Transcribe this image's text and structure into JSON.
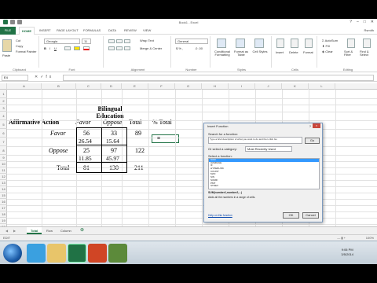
{
  "window": {
    "title": "Book1 - Excel",
    "user": "Rsmith"
  },
  "ribbon_tabs": [
    "FILE",
    "HOME",
    "INSERT",
    "PAGE LAYOUT",
    "FORMULAS",
    "DATA",
    "REVIEW",
    "VIEW"
  ],
  "ribbon": {
    "clipboard": {
      "cut": "Cut",
      "copy": "Copy",
      "format_painter": "Format Painter",
      "paste": "Paste",
      "group": "Clipboard"
    },
    "font": {
      "name": "Georgia",
      "size": "11",
      "group": "Font"
    },
    "alignment": {
      "wrap": "Wrap Text",
      "merge": "Merge & Center",
      "group": "Alignment"
    },
    "number": {
      "format": "General",
      "group": "Number"
    },
    "styles": {
      "conditional": "Conditional Formatting",
      "format_table": "Format as Table",
      "cell_styles": "Cell Styles",
      "group": "Styles"
    },
    "cells": {
      "insert": "Insert",
      "delete": "Delete",
      "format": "Format",
      "group": "Cells"
    },
    "editing": {
      "autosum": "AutoSum",
      "fill": "Fill",
      "clear": "Clear",
      "sort": "Sort & Filter",
      "find": "Find & Select",
      "group": "Editing"
    }
  },
  "formula_bar": {
    "name_box": "E4",
    "fx": "fx"
  },
  "columns": [
    "A",
    "B",
    "C",
    "D",
    "E",
    "F",
    "G",
    "H",
    "I",
    "J",
    "K",
    "L"
  ],
  "rows": [
    "1",
    "2",
    "3",
    "4",
    "5",
    "6",
    "7",
    "8",
    "9",
    "10",
    "11",
    "12",
    "13",
    "14",
    "15",
    "16",
    "17",
    "18",
    "19",
    "20",
    "21"
  ],
  "sheet": {
    "header_top": "Bilingual",
    "header_bottom": "Education",
    "affirmative": "Affirmative Action",
    "favor_col": "Favor",
    "oppose_col": "Oppose",
    "total_col": "Total",
    "pct_total": "% Total",
    "favor_row": "Favor",
    "oppose_row": "Oppose",
    "total_row": "Total",
    "r_favor_favor": "56",
    "r_favor_favor_exp": "26.54",
    "r_favor_oppose": "33",
    "r_favor_oppose_exp": "15.64",
    "r_favor_total": "89",
    "r_oppose_favor": "25",
    "r_oppose_favor_exp": "11.85",
    "r_oppose_oppose": "97",
    "r_oppose_oppose_exp": "45.97",
    "r_oppose_total": "122",
    "t_favor": "81",
    "t_oppose": "130",
    "t_total": "211",
    "active_cell": "="
  },
  "sheet_tabs": [
    "Total",
    "Row",
    "Column"
  ],
  "status": {
    "left": "EDIT",
    "zoom": "100%"
  },
  "dialog": {
    "title": "Insert Function",
    "help": "?",
    "close": "×",
    "search_label": "Search for a function:",
    "search_value": "Type a brief description of what you want to do and then click Go",
    "go": "Go",
    "category_label": "Or select a category:",
    "category_value": "Most Recently Used",
    "select_label": "Select a function:",
    "functions": [
      "SUM",
      "AVERAGE",
      "IF",
      "HYPERLINK",
      "COUNT",
      "MAX",
      "SIN",
      "SUMIF",
      "PMT",
      "STDEV"
    ],
    "syntax": "SUM(number1,number2,...)",
    "description": "Adds all the numbers in a range of cells.",
    "help_link": "Help on this function",
    "ok": "OK",
    "cancel": "Cancel"
  },
  "clock": {
    "time": "9:06 PM",
    "date": "3/5/2014"
  }
}
